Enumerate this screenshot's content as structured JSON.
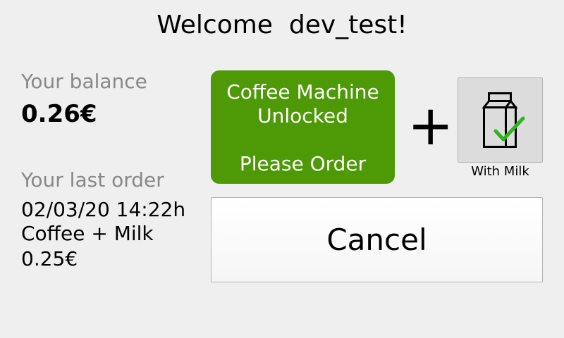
{
  "header": {
    "title": "Welcome  dev_test!"
  },
  "balance": {
    "label": "Your balance",
    "value": "0.26€"
  },
  "last_order": {
    "label": "Your last order",
    "datetime": "02/03/20 14:22h",
    "item": "Coffee + Milk",
    "price": "0.25€"
  },
  "status": {
    "line1": "Coffee Machine",
    "line2": "Unlocked",
    "line3": "Please Order",
    "color": "#4e9a06"
  },
  "milk_option": {
    "label": "With Milk",
    "icon": "milk-carton-check-icon",
    "check_color": "#2db31f"
  },
  "plus_symbol": "+",
  "cancel": {
    "label": "Cancel"
  }
}
